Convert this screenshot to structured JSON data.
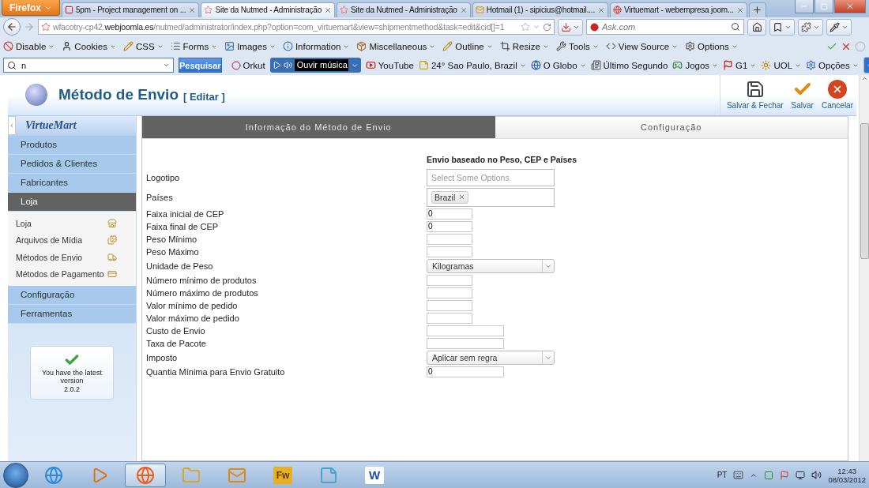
{
  "browser": {
    "menu_button": "Firefox",
    "tabs": [
      {
        "title": "5pm - Project management on ...",
        "selected": false
      },
      {
        "title": "Site da Nutmed - Administração",
        "selected": true
      },
      {
        "title": "Site da Nutmed - Administração",
        "selected": false
      },
      {
        "title": "Hotmail (1) - sipicius@hotmail....",
        "selected": false
      },
      {
        "title": "Virtuemart - webempresa joom...",
        "selected": false
      }
    ],
    "address": {
      "subdomain": "wfacotry-cp42.",
      "domain": "webjoomla.es",
      "path": "/nutmed/administrator/index.php?option=com_virtuemart&view=shipmentmethod&task=edit&cid[]=1"
    },
    "search_placeholder": "Ask.com"
  },
  "dev_toolbar": [
    "Disable",
    "Cookies",
    "CSS",
    "Forms",
    "Images",
    "Information",
    "Miscellaneous",
    "Outline",
    "Resize",
    "Tools",
    "View Source",
    "Options"
  ],
  "ask_toolbar": {
    "search_value": "n",
    "search_button": "Pesquisar",
    "orkut": "Orkut",
    "player": "Ouvir música",
    "links": [
      {
        "label": "YouTube",
        "dropdown": false
      },
      {
        "label": "24° Sao Paulo, Brazil",
        "dropdown": true
      },
      {
        "label": "O Globo",
        "dropdown": true
      },
      {
        "label": "Último Segundo",
        "dropdown": false
      },
      {
        "label": "Jogos",
        "dropdown": true
      },
      {
        "label": "G1",
        "dropdown": true
      },
      {
        "label": "UOL",
        "dropdown": true
      },
      {
        "label": "Opções",
        "dropdown": true
      }
    ]
  },
  "page": {
    "title": "Método de Envio",
    "subtitle": "[ Editar ]",
    "actions": [
      {
        "label": "Salvar & Fechar",
        "kind": "save"
      },
      {
        "label": "Salvar",
        "kind": "apply"
      },
      {
        "label": "Cancelar",
        "kind": "cancel"
      }
    ],
    "sidebar": {
      "logo": "VirtueMart",
      "items": [
        {
          "label": "Produtos",
          "selected": false
        },
        {
          "label": "Pedidos & Clientes",
          "selected": false
        },
        {
          "label": "Fabricantes",
          "selected": false
        },
        {
          "label": "Loja",
          "selected": true,
          "children": [
            {
              "label": "Loja"
            },
            {
              "label": "Arquivos de Mídia"
            },
            {
              "label": "Métodos de Envio"
            },
            {
              "label": "Métodos de Pagamento"
            }
          ]
        },
        {
          "label": "Configuração",
          "selected": false
        },
        {
          "label": "Ferramentas",
          "selected": false
        }
      ],
      "version_box": {
        "message": "You have the latest version",
        "version": "2.0.2"
      }
    },
    "tabs": [
      {
        "label": "Informação do Método de Envio",
        "selected": true
      },
      {
        "label": "Configuração",
        "selected": false
      }
    ],
    "form": {
      "heading": "Envio baseado no Peso, CEP e Países",
      "fields": [
        {
          "label": "Logotipo",
          "kind": "multiselect",
          "placeholder": "Select Some Options"
        },
        {
          "label": "Países",
          "kind": "tags",
          "tags": [
            "Brazil"
          ]
        },
        {
          "label": "Faixa inicial de CEP",
          "kind": "short",
          "value": "0"
        },
        {
          "label": "Faixa final de CEP",
          "kind": "short",
          "value": "0"
        },
        {
          "label": "Peso Mínimo",
          "kind": "short"
        },
        {
          "label": "Peso Máximo",
          "kind": "short"
        },
        {
          "label": "Unidade de Peso",
          "kind": "select",
          "value": "Kilogramas"
        },
        {
          "label": "Número mínimo de produtos",
          "kind": "short"
        },
        {
          "label": "Número máximo de produtos",
          "kind": "short"
        },
        {
          "label": "Valor mínimo de pedido",
          "kind": "short"
        },
        {
          "label": "Valor máximo de pedido",
          "kind": "short"
        },
        {
          "label": "Custo de Envio",
          "kind": "medium"
        },
        {
          "label": "Taxa de Pacote",
          "kind": "medium"
        },
        {
          "label": "Imposto",
          "kind": "select",
          "value": "Aplicar sem regra"
        },
        {
          "label": "Quantia Mínima para Envio Gratuito",
          "kind": "medium",
          "value": "0"
        }
      ]
    }
  },
  "taskbar": {
    "apps": [
      {
        "kind": "ie",
        "active": false
      },
      {
        "kind": "media",
        "active": false
      },
      {
        "kind": "firefox",
        "active": true
      },
      {
        "kind": "explorer",
        "active": false
      },
      {
        "kind": "outlook",
        "active": false
      },
      {
        "kind": "fireworks",
        "label": "Fw",
        "active": false
      },
      {
        "kind": "notes",
        "active": false
      },
      {
        "kind": "word",
        "label": "W",
        "active": false
      }
    ],
    "language": "PT",
    "time": "12:43",
    "date": "08/03/2012"
  }
}
